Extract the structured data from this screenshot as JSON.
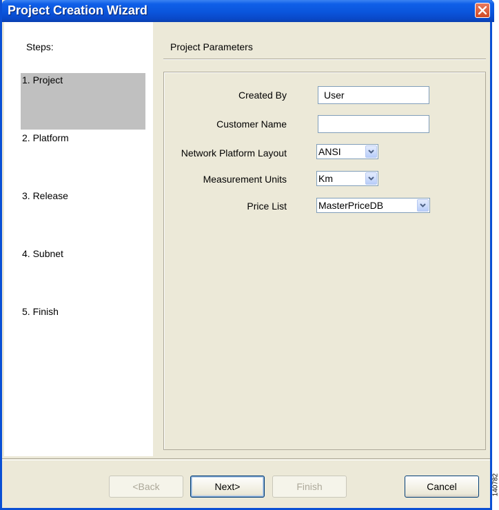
{
  "window": {
    "title": "Project Creation Wizard"
  },
  "steps": {
    "header": "Steps:",
    "items": [
      {
        "label": "1. Project",
        "active": true
      },
      {
        "label": "2. Platform",
        "active": false
      },
      {
        "label": "3. Release",
        "active": false
      },
      {
        "label": "4. Subnet",
        "active": false
      },
      {
        "label": "5. Finish",
        "active": false
      }
    ]
  },
  "parameters": {
    "header": "Project Parameters",
    "created_by": {
      "label": "Created By",
      "value": "User"
    },
    "customer_name": {
      "label": "Customer Name",
      "value": ""
    },
    "network_platform_layout": {
      "label": "Network Platform Layout",
      "value": "ANSI"
    },
    "measurement_units": {
      "label": "Measurement Units",
      "value": "Km"
    },
    "price_list": {
      "label": "Price List",
      "value": "MasterPriceDB"
    }
  },
  "buttons": {
    "back": "<Back",
    "next": "Next>",
    "finish": "Finish",
    "cancel": "Cancel"
  },
  "figure_id": "140782"
}
